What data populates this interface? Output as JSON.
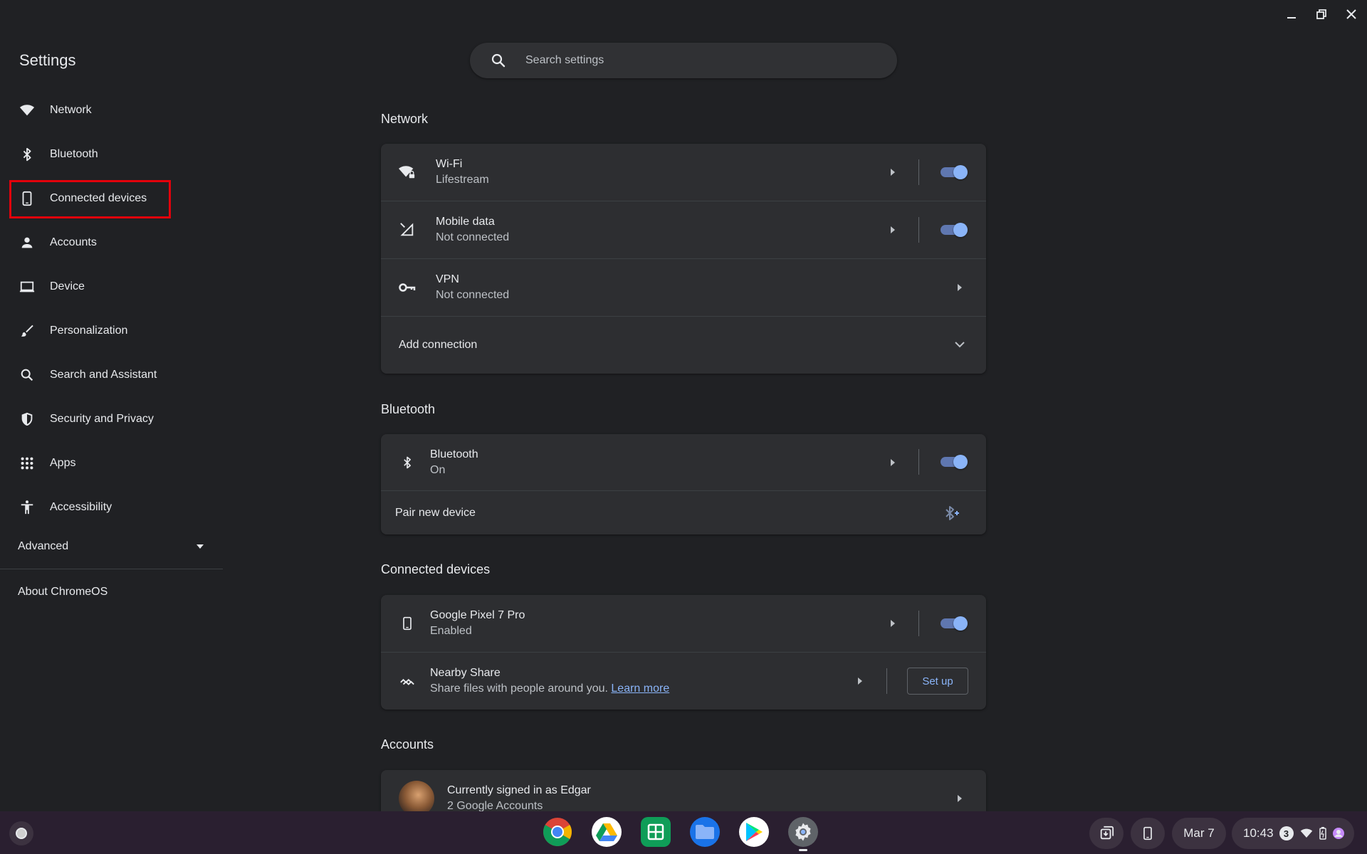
{
  "window": {
    "title": "Settings",
    "controls": [
      "minimize-icon",
      "maximize-icon",
      "close-icon"
    ]
  },
  "search": {
    "placeholder": "Search settings"
  },
  "sidebar": {
    "items": [
      {
        "label": "Network",
        "icon": "wifi-icon"
      },
      {
        "label": "Bluetooth",
        "icon": "bluetooth-icon"
      },
      {
        "label": "Connected devices",
        "icon": "phone-icon",
        "highlighted": true
      },
      {
        "label": "Accounts",
        "icon": "person-icon"
      },
      {
        "label": "Device",
        "icon": "laptop-icon"
      },
      {
        "label": "Personalization",
        "icon": "brush-icon"
      },
      {
        "label": "Search and Assistant",
        "icon": "search-icon"
      },
      {
        "label": "Security and Privacy",
        "icon": "shield-icon"
      },
      {
        "label": "Apps",
        "icon": "apps-grid-icon"
      },
      {
        "label": "Accessibility",
        "icon": "accessibility-icon"
      }
    ],
    "advanced": "Advanced",
    "about": "About ChromeOS"
  },
  "network": {
    "title": "Network",
    "wifi": {
      "title": "Wi-Fi",
      "subtitle": "Lifestream",
      "enabled": true
    },
    "mobile": {
      "title": "Mobile data",
      "subtitle": "Not connected",
      "enabled": true
    },
    "vpn": {
      "title": "VPN",
      "subtitle": "Not connected"
    },
    "add_connection": "Add connection"
  },
  "bluetooth": {
    "title": "Bluetooth",
    "row": {
      "title": "Bluetooth",
      "subtitle": "On",
      "enabled": true
    },
    "pair": "Pair new device"
  },
  "connected": {
    "title": "Connected devices",
    "phone": {
      "title": "Google Pixel 7 Pro",
      "subtitle": "Enabled",
      "enabled": true
    },
    "nearby": {
      "title": "Nearby Share",
      "subtitle": "Share files with people around you.",
      "link": "Learn more",
      "button": "Set up"
    }
  },
  "accounts": {
    "title": "Accounts",
    "row": {
      "title": "Currently signed in as Edgar",
      "subtitle": "2 Google Accounts"
    }
  },
  "shelf": {
    "apps": [
      "chrome-icon",
      "google-drive-icon",
      "google-sheets-icon",
      "files-icon",
      "play-store-icon",
      "settings-icon"
    ],
    "date": "Mar 7",
    "time": "10:43",
    "notifications": "3"
  },
  "colors": {
    "background": "#202124",
    "card": "#2d2e31",
    "accent": "#8ab4f8",
    "highlight_box": "#e3000b",
    "shelf": "#2a1f30"
  }
}
